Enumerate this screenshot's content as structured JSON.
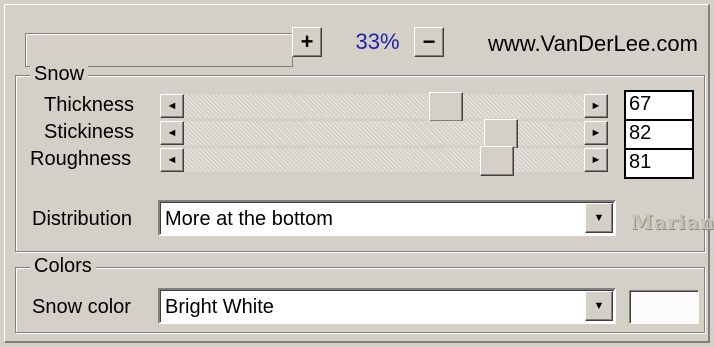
{
  "zoom": {
    "plus_label": "+",
    "value_label": "33%",
    "minus_label": "−"
  },
  "site_label": "www.VanDerLee.com",
  "snow": {
    "title": "Snow",
    "sliders": [
      {
        "label": "Thickness",
        "value": "67",
        "level": 0.67
      },
      {
        "label": "Stickiness",
        "value": "82",
        "level": 0.82
      },
      {
        "label": "Roughness",
        "value": "81",
        "level": 0.81
      }
    ],
    "distribution": {
      "label": "Distribution",
      "selected": "More at the bottom"
    }
  },
  "colors": {
    "title": "Colors",
    "snow_color": {
      "label": "Snow color",
      "selected": "Bright White",
      "swatch_color": "#fcfcfc"
    }
  },
  "watermark": "Marian",
  "icons": {
    "arrow_left": "◄",
    "arrow_right": "►",
    "arrow_down": "▼"
  }
}
